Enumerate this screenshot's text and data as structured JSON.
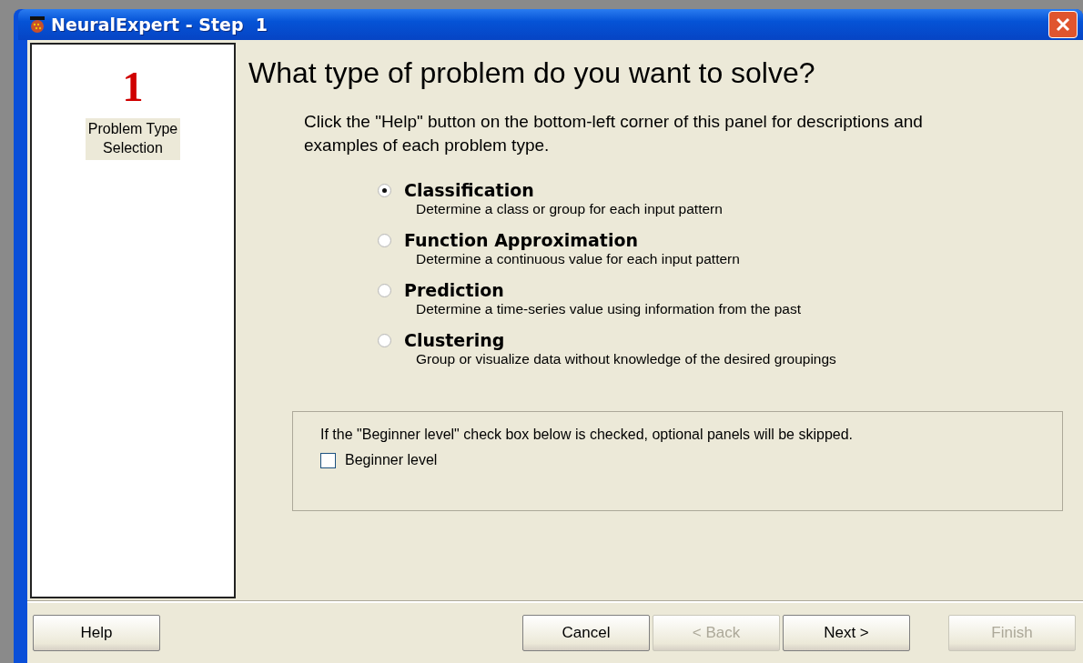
{
  "window": {
    "title": "NeuralExpert - Step  1"
  },
  "step": {
    "number": "1",
    "label": "Problem Type Selection"
  },
  "heading": "What type of problem do you want to solve?",
  "description": "Click the \"Help\" button on the bottom-left corner of this panel for descriptions and examples of each problem type.",
  "options": [
    {
      "label": "Classification",
      "description": "Determine a class or group for each input pattern",
      "selected": true
    },
    {
      "label": "Function Approximation",
      "description": "Determine a continuous value for each input pattern",
      "selected": false
    },
    {
      "label": "Prediction",
      "description": "Determine a time-series value using information from the past",
      "selected": false
    },
    {
      "label": "Clustering",
      "description": "Group or visualize data without knowledge of the desired groupings",
      "selected": false
    }
  ],
  "beginner": {
    "note": "If the \"Beginner level\" check box below is checked, optional panels will be skipped.",
    "label": "Beginner level",
    "checked": false
  },
  "buttons": [
    {
      "label": "Help",
      "kind": "left",
      "disabled": false
    },
    {
      "label": "Cancel",
      "kind": "right",
      "disabled": false
    },
    {
      "label": "< Back",
      "kind": "right",
      "disabled": true
    },
    {
      "label": "Next >",
      "kind": "right",
      "disabled": false
    },
    {
      "label": "Finish",
      "kind": "gap",
      "disabled": true
    }
  ]
}
